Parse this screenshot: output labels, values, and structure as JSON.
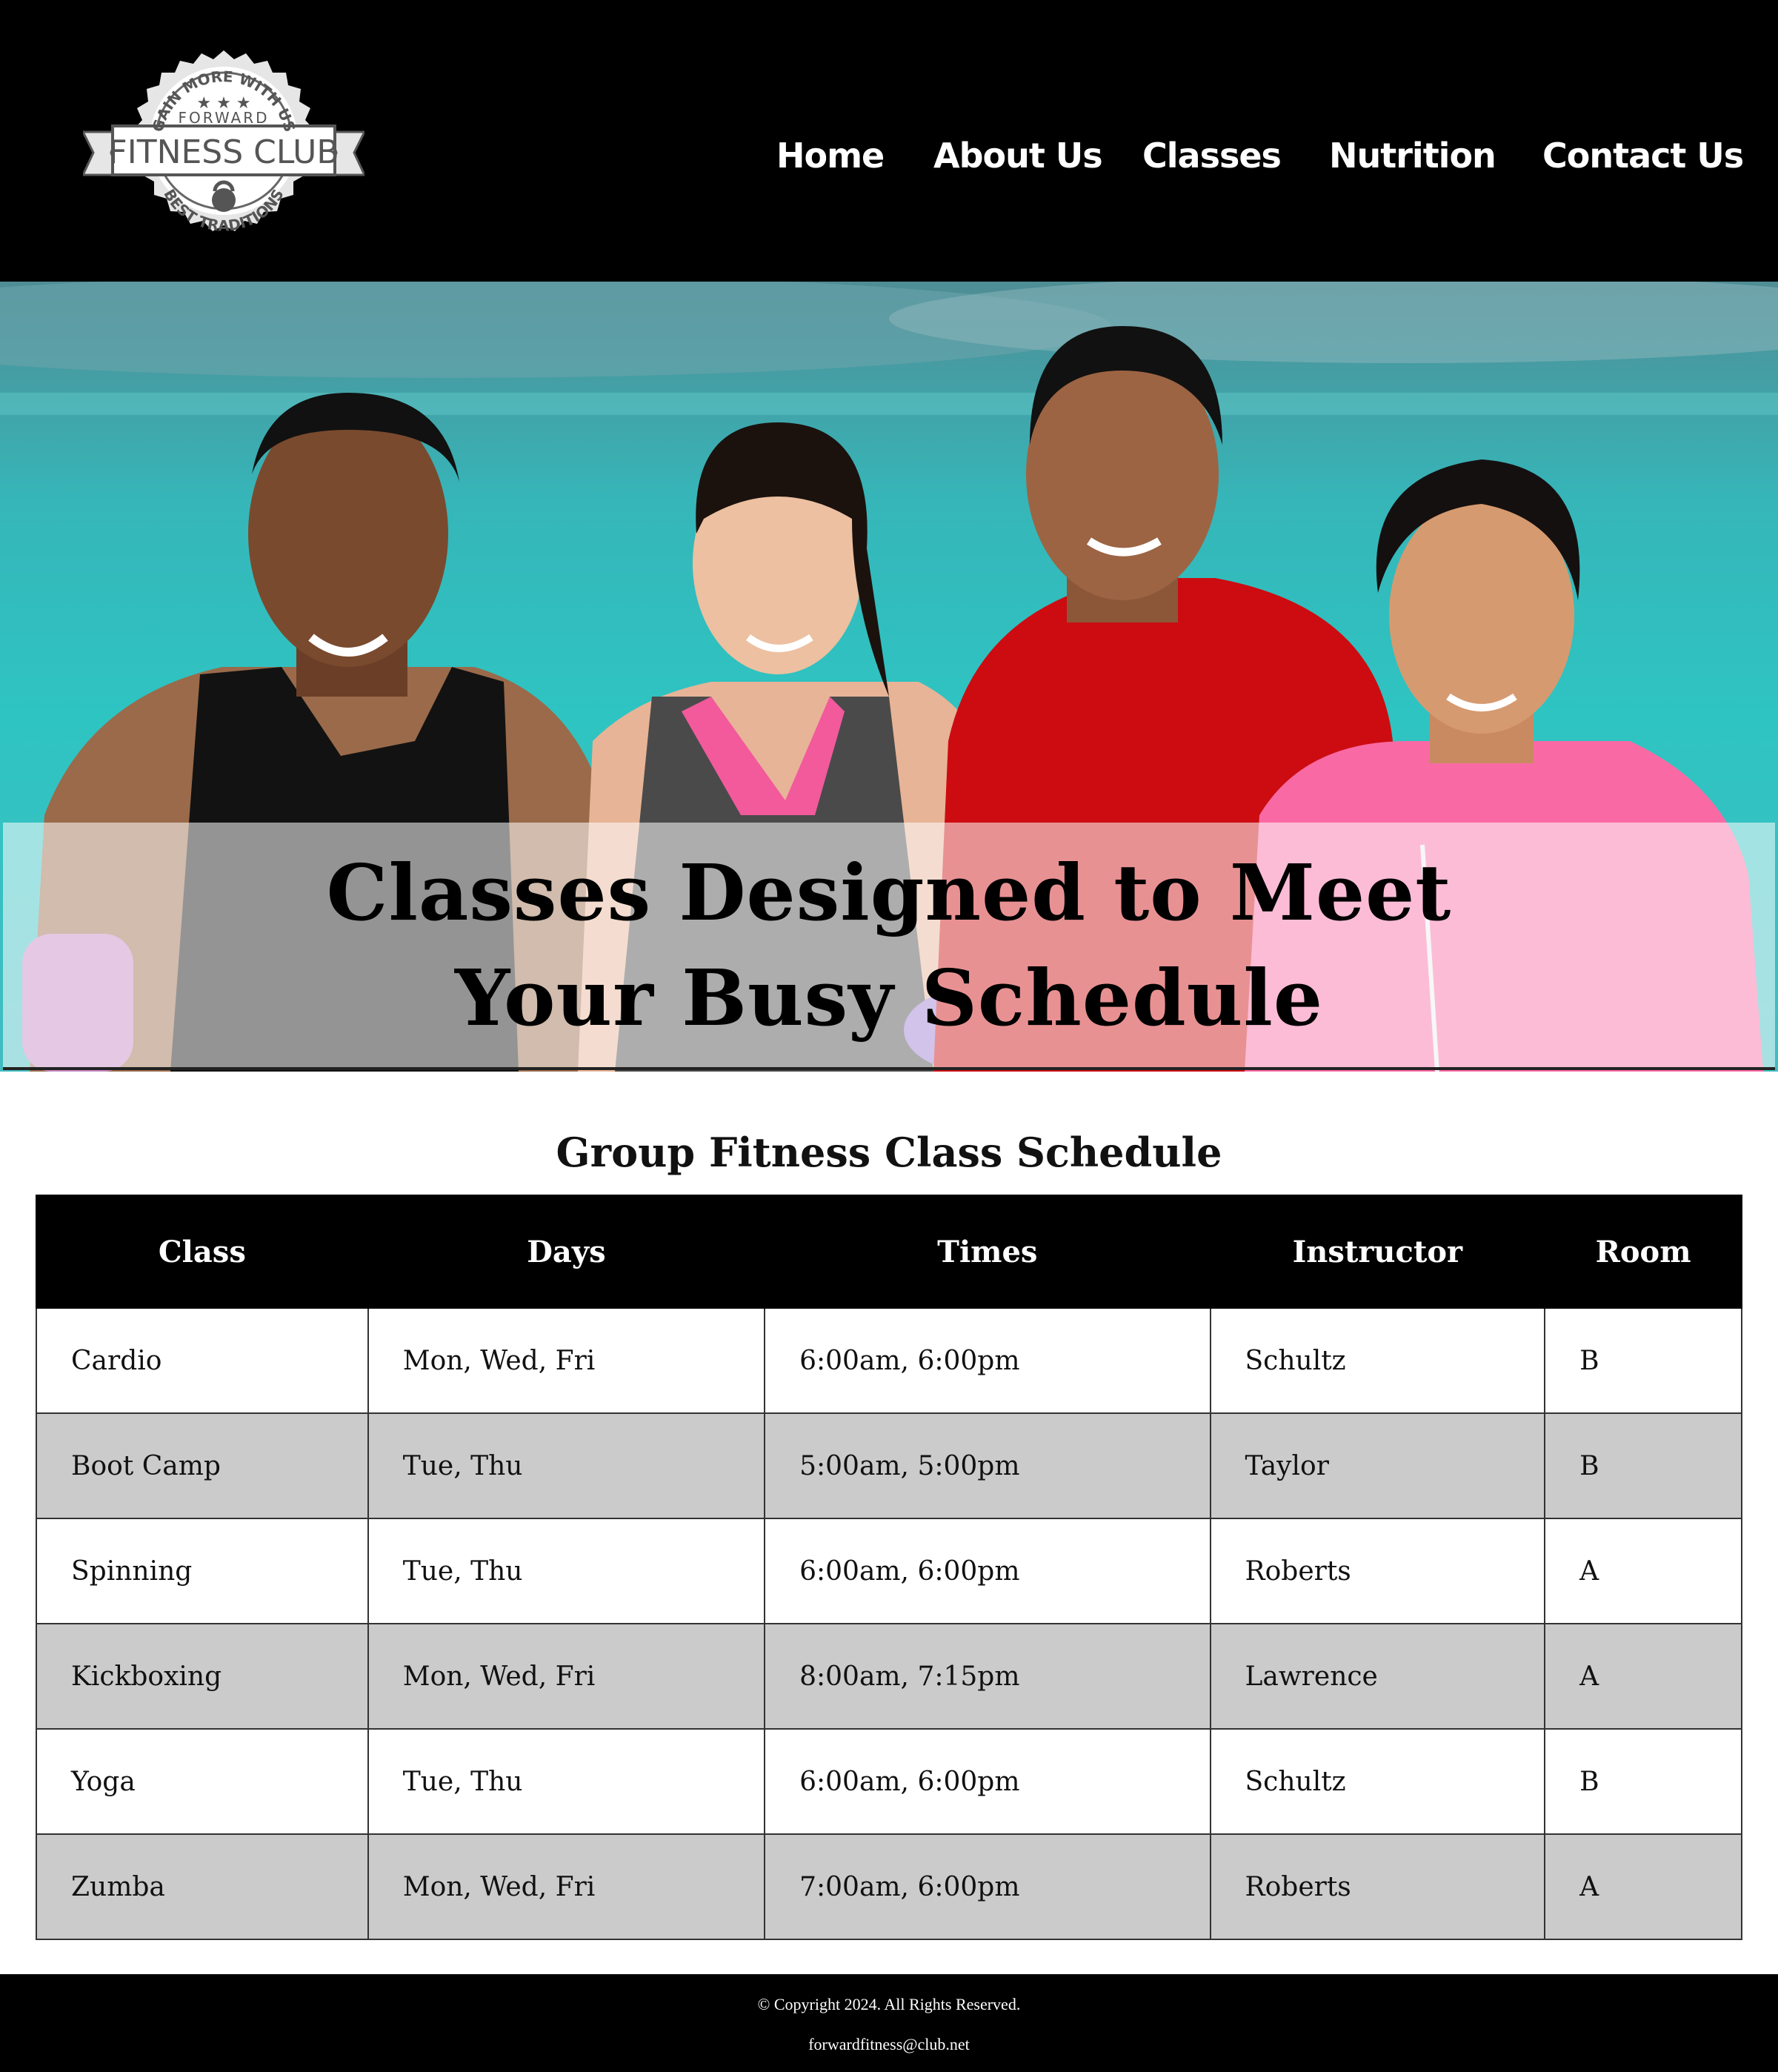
{
  "logo": {
    "top_arc": "GAIN MORE WITH US",
    "brand_small": "FORWARD",
    "brand_main": "FITNESS CLUB",
    "bottom_arc": "BEST TRADITIONS"
  },
  "nav": {
    "items": [
      {
        "label": "Home"
      },
      {
        "label": "About Us"
      },
      {
        "label": "Classes"
      },
      {
        "label": "Nutrition"
      },
      {
        "label": "Contact Us"
      }
    ]
  },
  "hero": {
    "title_line1": "Classes Designed to Meet",
    "title_line2": "Your Busy Schedule"
  },
  "schedule": {
    "title": "Group Fitness Class Schedule",
    "headers": [
      "Class",
      "Days",
      "Times",
      "Instructor",
      "Room"
    ],
    "rows": [
      [
        "Cardio",
        "Mon, Wed, Fri",
        "6:00am, 6:00pm",
        "Schultz",
        "B"
      ],
      [
        "Boot Camp",
        "Tue, Thu",
        "5:00am, 5:00pm",
        "Taylor",
        "B"
      ],
      [
        "Spinning",
        "Tue, Thu",
        "6:00am, 6:00pm",
        "Roberts",
        "A"
      ],
      [
        "Kickboxing",
        "Mon, Wed, Fri",
        "8:00am, 7:15pm",
        "Lawrence",
        "A"
      ],
      [
        "Yoga",
        "Tue, Thu",
        "6:00am, 6:00pm",
        "Schultz",
        "B"
      ],
      [
        "Zumba",
        "Mon, Wed, Fri",
        "7:00am, 6:00pm",
        "Roberts",
        "A"
      ]
    ]
  },
  "footer": {
    "copyright": "© Copyright 2024. All Rights Reserved.",
    "email": "forwardfitness@club.net"
  },
  "colors": {
    "header_bg": "#000000",
    "table_header_bg": "#000000",
    "alt_row_bg": "#cbcbcb",
    "hero_bg": "#2ec4c2"
  }
}
